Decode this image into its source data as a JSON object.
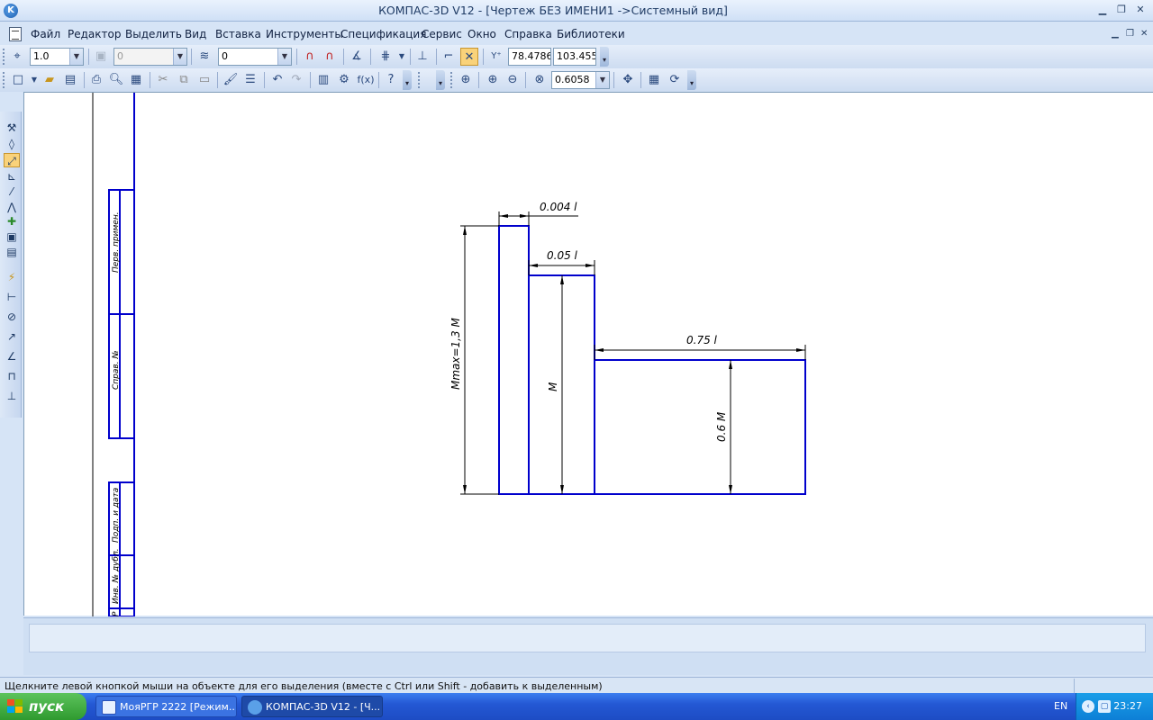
{
  "window": {
    "title": "КОМПАС-3D V12 - [Чертеж БЕЗ ИМЕНИ1 ->Системный вид]",
    "app_icon": "K",
    "minimize": "▁",
    "maximize": "❐",
    "close": "✕"
  },
  "menu": {
    "items": [
      "Файл",
      "Редактор",
      "Выделить",
      "Вид",
      "Вставка",
      "Инструменты",
      "Спецификация",
      "Сервис",
      "Окно",
      "Справка",
      "Библиотеки"
    ],
    "doc_minimize": "▁",
    "doc_restore": "❐",
    "doc_close": "✕"
  },
  "toolbar_props": {
    "scale_value": "1.0",
    "layer_value": "0",
    "style_value": "0",
    "coord_x": "78.4786",
    "coord_y": "103.455"
  },
  "toolbar_std": {
    "zoom_value": "0.6058"
  },
  "drawing": {
    "dim_top": "0.004 l",
    "dim_mid": "0.05 l",
    "dim_right": "0.75 l",
    "dim_left": "Mmax=1,3 M",
    "dim_inner": "M",
    "dim_right_vert": "0.6 M",
    "stamp_1": "Перв. примен.",
    "stamp_2": "Справ. №",
    "stamp_3": "Подп. и дата",
    "stamp_4": "Инв. № дубл.",
    "stamp_5": "Р"
  },
  "status": {
    "text": "Щелкните левой кнопкой мыши на объекте для его выделения (вместе с Ctrl или Shift - добавить к выделенным)"
  },
  "taskbar": {
    "start_label": "пуск",
    "task1": "МояРГР 2222 [Режим...",
    "task2": "КОМПАС-3D V12 - [Ч...",
    "lang": "EN",
    "clock": "23:27"
  },
  "colors": {
    "drawing_line": "#0000cc",
    "frame_line": "#0000cc",
    "taskbar": "#2458d4",
    "start": "#2f9a2f"
  }
}
